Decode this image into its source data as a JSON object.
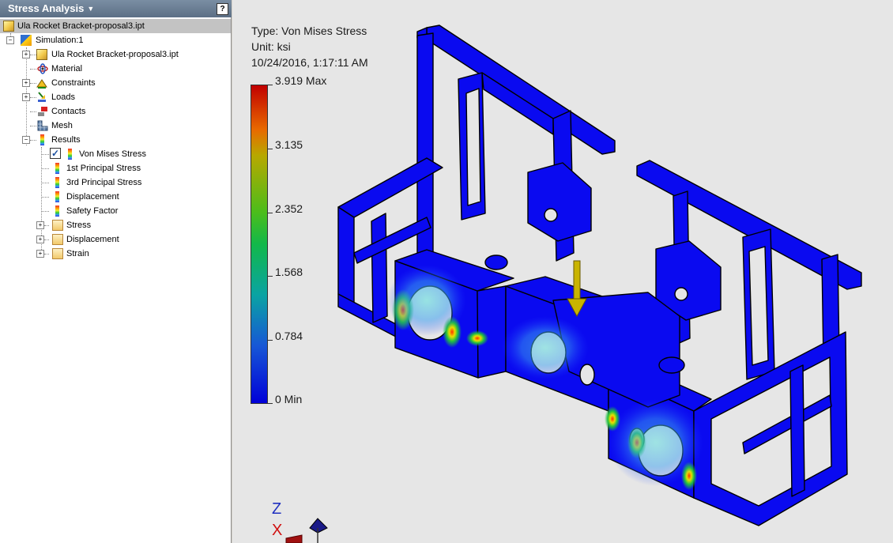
{
  "browser": {
    "title": "Stress Analysis",
    "help_glyph": "?",
    "root": "Ula Rocket Bracket-proposal3.ipt",
    "simulation": "Simulation:1",
    "items": [
      {
        "label": "Ula Rocket Bracket-proposal3.ipt",
        "icon": "part-icon"
      },
      {
        "label": "Material",
        "icon": "material-icon"
      },
      {
        "label": "Constraints",
        "icon": "constraints-icon"
      },
      {
        "label": "Loads",
        "icon": "loads-icon"
      },
      {
        "label": "Contacts",
        "icon": "contacts-icon"
      },
      {
        "label": "Mesh",
        "icon": "mesh-icon"
      },
      {
        "label": "Results",
        "icon": "results-icon"
      }
    ],
    "results": [
      {
        "label": "Von Mises Stress",
        "checked": true
      },
      {
        "label": "1st Principal Stress"
      },
      {
        "label": "3rd Principal Stress"
      },
      {
        "label": "Displacement"
      },
      {
        "label": "Safety Factor"
      }
    ],
    "folders": [
      {
        "label": "Stress"
      },
      {
        "label": "Displacement"
      },
      {
        "label": "Strain"
      }
    ]
  },
  "viewport": {
    "type_text": "Type: Von Mises Stress",
    "unit_text": "Unit: ksi",
    "timestamp": "10/24/2016, 1:17:11 AM",
    "legend": [
      "3.919 Max",
      "3.135",
      "2.352",
      "1.568",
      "0.784",
      "0 Min"
    ],
    "axis_x": "X",
    "axis_z": "Z"
  },
  "colors": {
    "model_blue": "#0a0af0",
    "stress_high": "#ff2000",
    "load_arrow": "#c9b400"
  }
}
